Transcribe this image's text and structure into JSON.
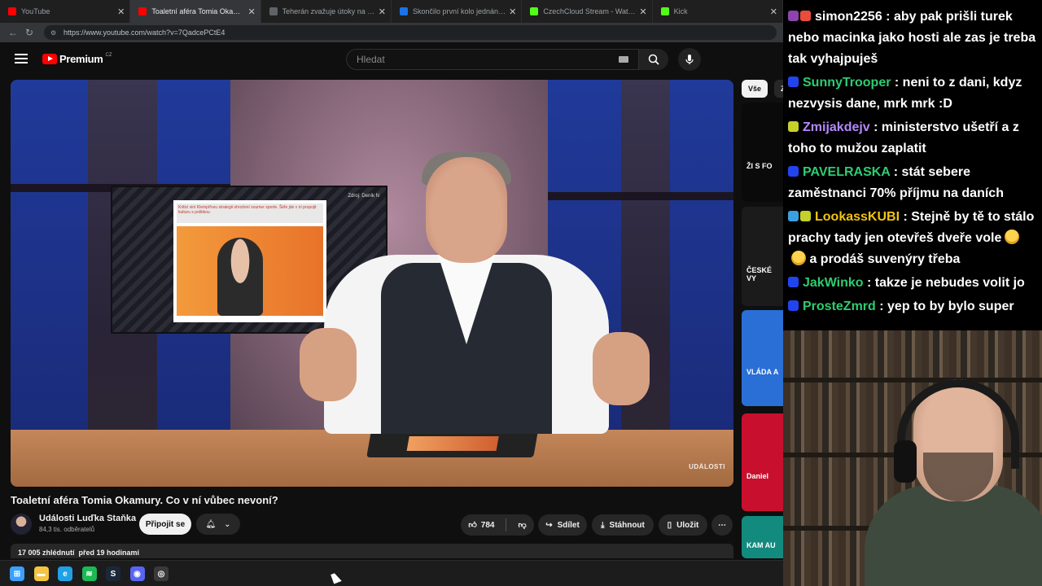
{
  "browser": {
    "tabs": [
      {
        "title": "YouTube",
        "fav_color": "#ff0000",
        "active": false
      },
      {
        "title": "Toaletní aféra Tomia Okamury. Co",
        "fav_color": "#ff0000",
        "active": true
      },
      {
        "title": "Teherán zvažuje útoky na vojenské",
        "fav_color": "#5f6368",
        "active": false
      },
      {
        "title": "Skončilo první kolo jednání minist",
        "fav_color": "#1a73e8",
        "active": false
      },
      {
        "title": "CzechCloud Stream - Watch Live o",
        "fav_color": "#53fc18",
        "active": false
      },
      {
        "title": "Kick",
        "fav_color": "#53fc18",
        "active": false
      }
    ],
    "url": "https://www.youtube.com/watch?v=7QadcePCtE4"
  },
  "youtube": {
    "logo_text": "Premium",
    "country_code": "CZ",
    "search_placeholder": "Hledat",
    "video": {
      "overlay_source": "Zdroj: Deník N",
      "overlay_headline": "Kritici viní Klempířovu strategii ohrožení soumer sporte. Šéfe jde v ní propojit kulturu s politikou",
      "brand_watermark": "UDÁLOSTI"
    },
    "title": "Toaletní aféra Tomia Okamury. Co v ní vůbec nevoní?",
    "channel": {
      "name": "Události Luďka Staňka",
      "subscribers": "84,3 tis. odběratelů"
    },
    "join_label": "Připojit se",
    "like_count": "784",
    "share_label": "Sdílet",
    "download_label": "Stáhnout",
    "save_label": "Uložit",
    "views_line": "17 005 zhlédnutí  před 19 hodinami",
    "chips": [
      "Vše",
      "Z"
    ],
    "thumbs": [
      {
        "caption": "ŽI S FO",
        "color": "#0a0a0a"
      },
      {
        "caption": "ČESKÉ VY",
        "color": "#1b1b1b"
      },
      {
        "caption": "VLÁDA A",
        "color": "#2a6fd6"
      },
      {
        "caption": "Daniel",
        "color": "#c8102e"
      },
      {
        "caption": "KAM AU",
        "color": "#138a7e"
      }
    ]
  },
  "chat": {
    "messages": [
      {
        "user": "simon2256",
        "color": "#ffffff",
        "badges": [
          "#8e44ad",
          "#e74c3c"
        ],
        "text": "aby pak prišli turek nebo macinka jako hosti ale zas je treba tak vyhajpuješ",
        "emotes": 0
      },
      {
        "user": "SunnyTrooper",
        "color": "#2ecc71",
        "badges": [
          "#2244ee"
        ],
        "text": "neni to z dani, kdyz nezvysis dane, mrk mrk :D",
        "emotes": 0
      },
      {
        "user": "Zmijakdejv",
        "color": "#b388ff",
        "badges": [
          "#c5d12a"
        ],
        "text": "ministerstvo ušetří a z toho to mužou zaplatit",
        "emotes": 0
      },
      {
        "user": "PAVELRASKA",
        "color": "#2ecc71",
        "badges": [
          "#2244ee"
        ],
        "text": "stát sebere zaměstnanci 70% příjmu na daních",
        "emotes": 0
      },
      {
        "user": "LookassKUBI",
        "color": "#f1c40f",
        "badges": [
          "#3aa0e0",
          "#c5d12a"
        ],
        "text": "Stejně by tě to stálo prachy tady jen otevřeš dveře vole",
        "text2": "a prodáš suvenýry třeba",
        "emotes": 2
      },
      {
        "user": "JakWinko",
        "color": "#2ecc71",
        "badges": [
          "#2244ee"
        ],
        "text": "takze je nebudes volit jo",
        "emotes": 0
      },
      {
        "user": "ProsteZmrd",
        "color": "#2ecc71",
        "badges": [
          "#2244ee"
        ],
        "text": "yep to by bylo super",
        "emotes": 0
      }
    ]
  },
  "taskbar": {
    "icons": [
      {
        "name": "windows-start-icon",
        "color": "#3aa0ff",
        "glyph": "⊞"
      },
      {
        "name": "file-explorer-icon",
        "color": "#f4c542",
        "glyph": "▬"
      },
      {
        "name": "edge-browser-icon",
        "color": "#1fa1e6",
        "glyph": "e"
      },
      {
        "name": "spotify-icon",
        "color": "#1db954",
        "glyph": "≋"
      },
      {
        "name": "steam-icon",
        "color": "#1b2838",
        "glyph": "S"
      },
      {
        "name": "discord-icon",
        "color": "#5865f2",
        "glyph": "◉"
      },
      {
        "name": "obs-icon",
        "color": "#3a3a3a",
        "glyph": "◎"
      }
    ]
  }
}
